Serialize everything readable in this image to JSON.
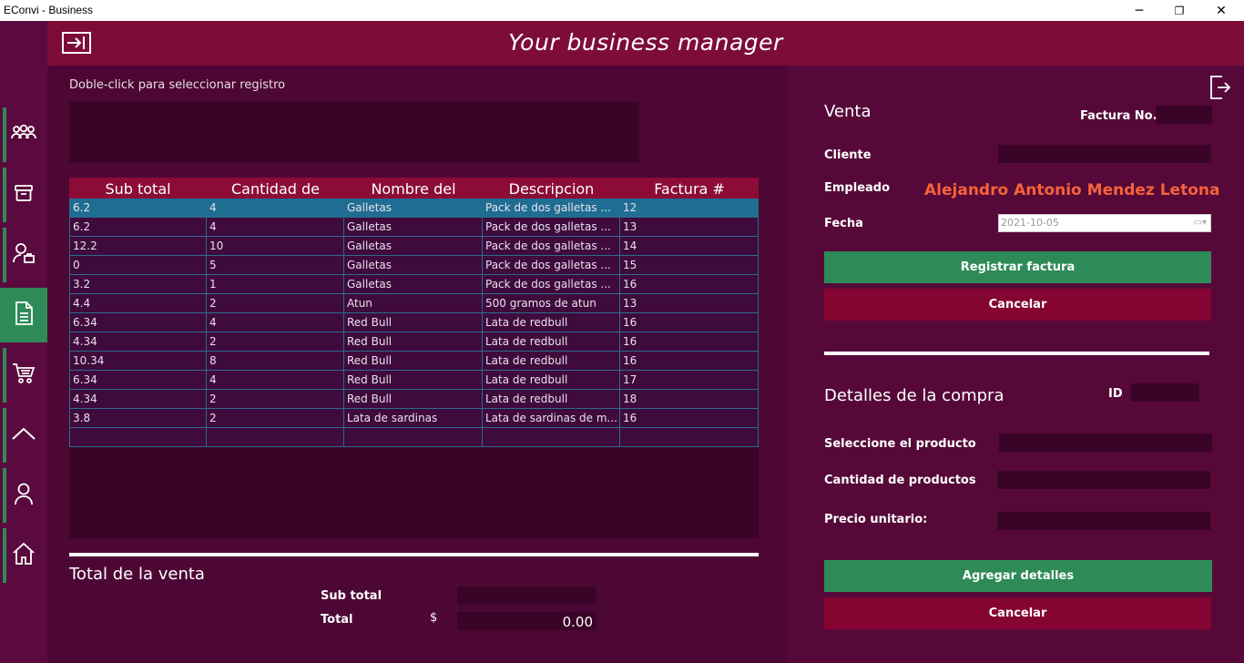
{
  "window": {
    "title": "EConvi - Business",
    "minimize": "─",
    "maximize": "❐",
    "close": "✕"
  },
  "header": {
    "title": "Your business manager",
    "toggle_icon": "sidebar-toggle-icon"
  },
  "sidebar": {
    "items": [
      {
        "name": "users-icon",
        "active": false
      },
      {
        "name": "archive-icon",
        "active": false
      },
      {
        "name": "user-box-icon",
        "active": false
      },
      {
        "name": "document-icon",
        "active": true
      },
      {
        "name": "cart-icon",
        "active": false
      },
      {
        "name": "chevron-up-icon",
        "active": false
      },
      {
        "name": "person-icon",
        "active": false
      },
      {
        "name": "home-icon",
        "active": false
      }
    ]
  },
  "left": {
    "hint": "Doble-click para seleccionar registro",
    "grid": {
      "columns": [
        "Sub total",
        "Cantidad de",
        "Nombre del",
        "Descripcion",
        "Factura #"
      ],
      "rows": [
        [
          "6.2",
          "4",
          "Galletas",
          "Pack de dos galletas ...",
          "12"
        ],
        [
          "6.2",
          "4",
          "Galletas",
          "Pack de dos galletas ...",
          "13"
        ],
        [
          "12.2",
          "10",
          "Galletas",
          "Pack de dos galletas ...",
          "14"
        ],
        [
          "0",
          "5",
          "Galletas",
          "Pack de dos galletas ...",
          "15"
        ],
        [
          "3.2",
          "1",
          "Galletas",
          "Pack de dos galletas ...",
          "16"
        ],
        [
          "4.4",
          "2",
          "Atun",
          "500 gramos de atun",
          "13"
        ],
        [
          "6.34",
          "4",
          "Red Bull",
          "Lata de redbull",
          "16"
        ],
        [
          "4.34",
          "2",
          "Red Bull",
          "Lata de redbull",
          "16"
        ],
        [
          "10.34",
          "8",
          "Red Bull",
          "Lata de redbull",
          "16"
        ],
        [
          "6.34",
          "4",
          "Red Bull",
          "Lata de redbull",
          "17"
        ],
        [
          "4.34",
          "2",
          "Red Bull",
          "Lata de redbull",
          "18"
        ],
        [
          "3.8",
          "2",
          "Lata de sardinas",
          "Lata de sardinas de m...",
          "16"
        ],
        [
          "",
          "",
          "",
          "",
          ""
        ]
      ],
      "selected_row": 0
    },
    "total_title": "Total de la venta",
    "subtotal_label": "Sub total",
    "subtotal_value": "",
    "total_label": "Total",
    "currency": "$",
    "total_value": "0.00"
  },
  "right": {
    "logout_icon": "logout-icon",
    "venta_title": "Venta",
    "factura_label": "Factura No.",
    "factura_value": "",
    "cliente_label": "Cliente",
    "cliente_value": "",
    "empleado_label": "Empleado",
    "empleado_value": "Alejandro Antonio Mendez Letona",
    "fecha_label": "Fecha",
    "fecha_value": "2021-10-05",
    "registrar_button": "Registrar factura",
    "cancelar_button": "Cancelar",
    "detalles_title": "Detalles de la compra",
    "id_label": "ID",
    "id_value": "",
    "producto_label": "Seleccione el producto",
    "producto_value": "",
    "cantidad_label": "Cantidad de productos",
    "cantidad_value": "",
    "precio_label": "Precio unitario:",
    "precio_value": "",
    "agregar_button": "Agregar detalles",
    "cancelar2_button": "Cancelar"
  },
  "colors": {
    "accent_green": "#2e8b57",
    "accent_red": "#850432",
    "header": "#7d0c37",
    "employee": "#f7623b"
  }
}
